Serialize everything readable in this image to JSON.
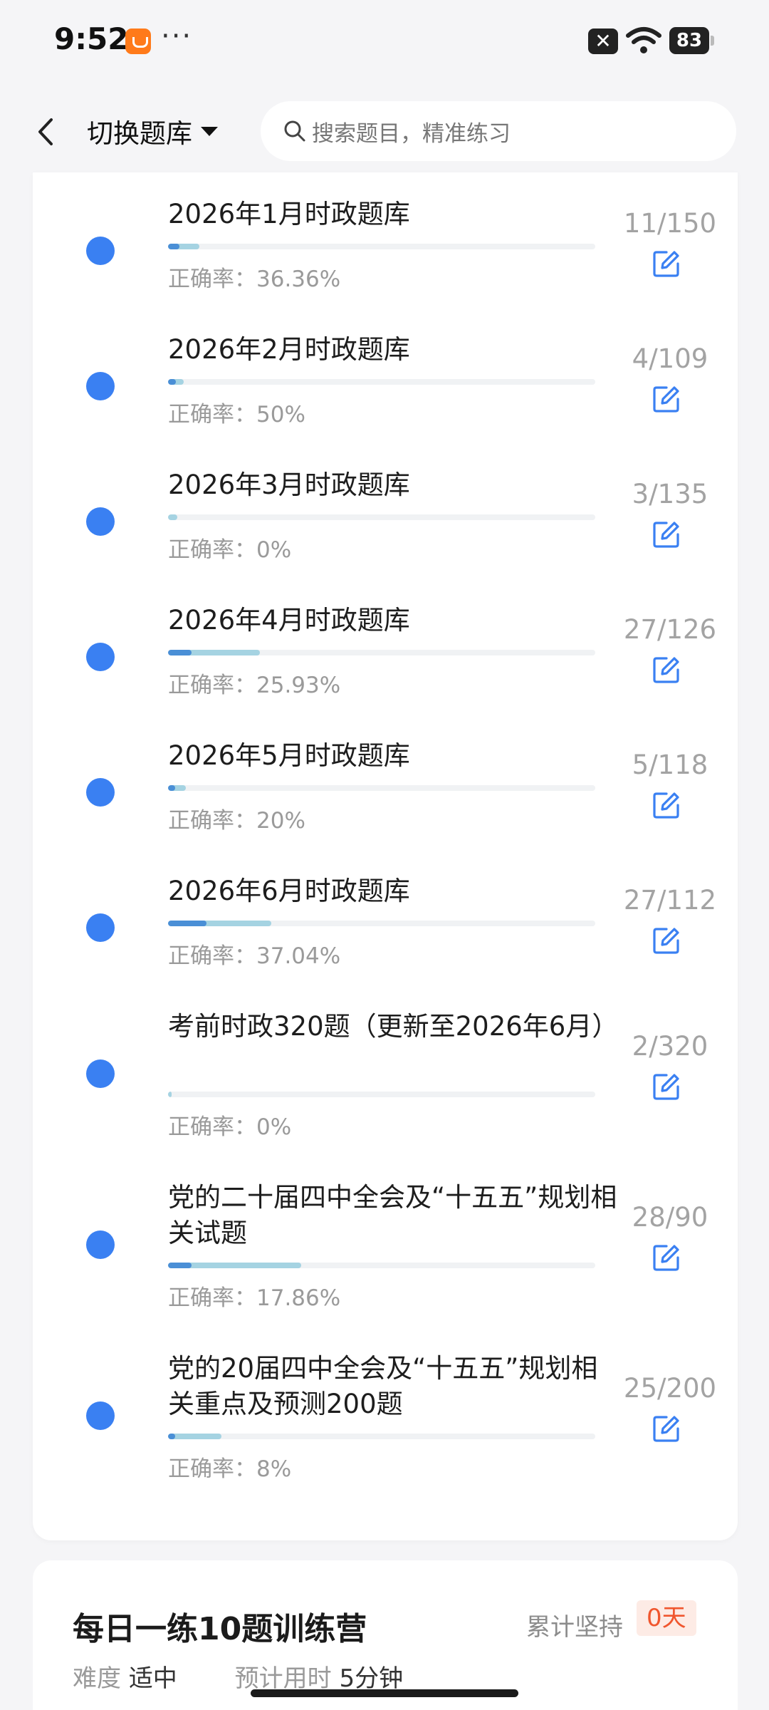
{
  "status_bar": {
    "time": "9:52",
    "more": "···",
    "close": "✕",
    "battery": "83"
  },
  "header": {
    "switch_bank_label": "切换题库",
    "search_placeholder": "搜索题目，精准练习"
  },
  "question_banks": [
    {
      "title": "2026年1月时政题库",
      "accuracy_label": "正确率：",
      "accuracy": "36.36%",
      "count": "11/150",
      "done_fraction": 0.0733,
      "correct_fraction": 0.0267
    },
    {
      "title": "2026年2月时政题库",
      "accuracy_label": "正确率：",
      "accuracy": "50%",
      "count": "4/109",
      "done_fraction": 0.0367,
      "correct_fraction": 0.0183
    },
    {
      "title": "2026年3月时政题库",
      "accuracy_label": "正确率：",
      "accuracy": "0%",
      "count": "3/135",
      "done_fraction": 0.0222,
      "correct_fraction": 0
    },
    {
      "title": "2026年4月时政题库",
      "accuracy_label": "正确率：",
      "accuracy": "25.93%",
      "count": "27/126",
      "done_fraction": 0.2143,
      "correct_fraction": 0.0556
    },
    {
      "title": "2026年5月时政题库",
      "accuracy_label": "正确率：",
      "accuracy": "20%",
      "count": "5/118",
      "done_fraction": 0.0424,
      "correct_fraction": 0.0085
    },
    {
      "title": "2026年6月时政题库",
      "accuracy_label": "正确率：",
      "accuracy": "37.04%",
      "count": "27/112",
      "done_fraction": 0.2411,
      "correct_fraction": 0.0893
    },
    {
      "title": "考前时政320题（更新至2026年6月）",
      "accuracy_label": "正确率：",
      "accuracy": "0%",
      "count": "2/320",
      "done_fraction": 0.0063,
      "correct_fraction": 0
    },
    {
      "title": "党的二十届四中全会及“十五五”规划相关试题",
      "accuracy_label": "正确率：",
      "accuracy": "17.86%",
      "count": "28/90",
      "done_fraction": 0.3111,
      "correct_fraction": 0.0556
    },
    {
      "title": "党的20届四中全会及“十五五”规划相关重点及预测200题",
      "accuracy_label": "正确率：",
      "accuracy": "8%",
      "count": "25/200",
      "done_fraction": 0.125,
      "correct_fraction": 0.01
    }
  ],
  "camp": {
    "title": "每日一练10题训练营",
    "streak_label": "累计坚持",
    "streak_value": "0天",
    "difficulty_label": "难度",
    "difficulty_value": "适中",
    "time_label": "预计用时",
    "time_value": "5分钟"
  },
  "colors": {
    "dot": "#3a80f2",
    "progress_done": "#a5d3e2",
    "progress_correct": "#4a8fd6",
    "edit_icon": "#3a80f2",
    "streak": "#f0562e"
  }
}
